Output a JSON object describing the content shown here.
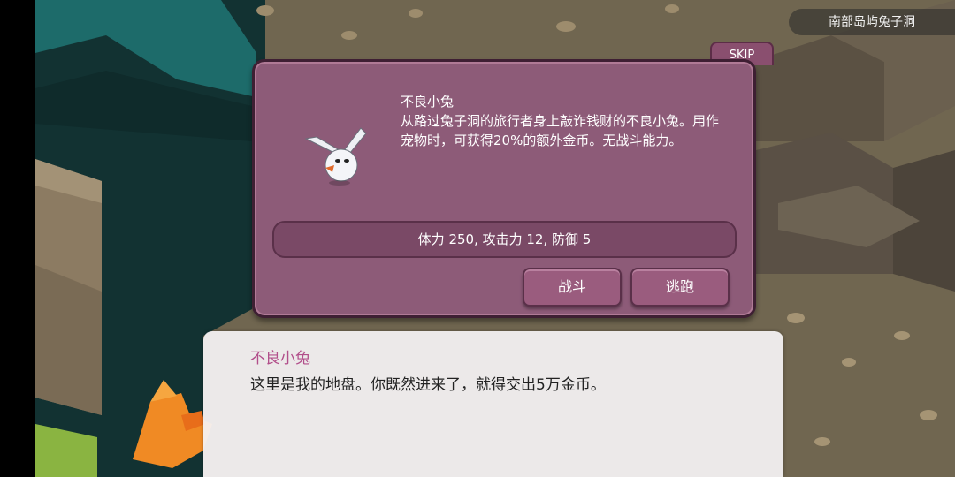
{
  "location": "南部岛屿兔子洞",
  "skip_label": "SKIP",
  "monster": {
    "icon": "white-rabbit-icon",
    "name": "不良小兔",
    "description": "从路过兔子洞的旅行者身上敲诈钱财的不良小兔。用作宠物时，可获得20%的额外金币。无战斗能力。",
    "stats": "体力 250, 攻击力 12, 防御 5"
  },
  "actions": {
    "fight_label": "战斗",
    "flee_label": "逃跑"
  },
  "dialog": {
    "speaker": "不良小兔",
    "text": "这里是我的地盘。你既然进来了，就得交出5万金币。"
  },
  "colors": {
    "panel": "#8d5b78",
    "speaker_name": "#b24f8b",
    "water": "#1b6b6a"
  }
}
